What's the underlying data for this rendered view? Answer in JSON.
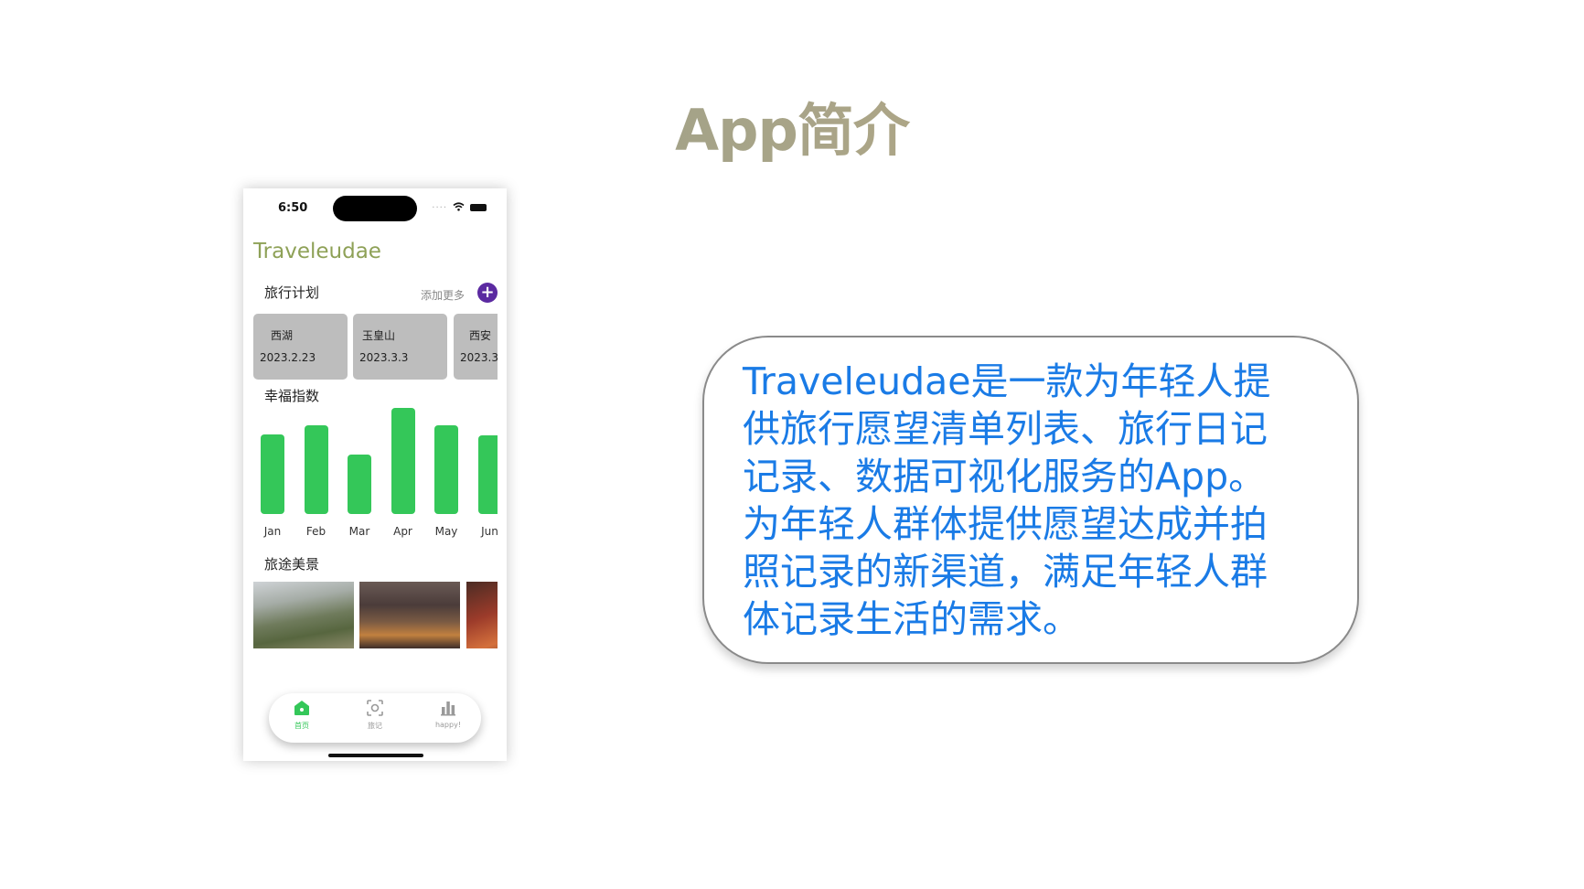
{
  "slide": {
    "title": "App简介"
  },
  "phone": {
    "status_time": "6:50",
    "app_title": "Traveleudae",
    "plan": {
      "title": "旅行计划",
      "add_more": "添加更多",
      "add_icon": "+",
      "cards": [
        {
          "name": "西湖",
          "date": "2023.2.23"
        },
        {
          "name": "玉皇山",
          "date": "2023.3.3"
        },
        {
          "name": "西安",
          "date": "2023.3"
        }
      ]
    },
    "happiness": {
      "title": "幸福指数",
      "months": [
        "Jan",
        "Feb",
        "Mar",
        "Apr",
        "May",
        "Jun"
      ],
      "values": [
        0.74,
        0.82,
        0.55,
        0.98,
        0.82,
        0.73
      ],
      "bar_color": "#34c759"
    },
    "scenery": {
      "title": "旅途美景"
    },
    "tabs": [
      {
        "label": "首页",
        "icon": "home-icon"
      },
      {
        "label": "旅记",
        "icon": "camera-icon"
      },
      {
        "label": "happy!",
        "icon": "bar-chart-icon"
      }
    ]
  },
  "description": {
    "lines": [
      "Traveleudae是一款为年轻人提",
      "供旅行愿望清单列表、旅行日记",
      "记录、数据可视化服务的App。",
      "为年轻人群体提供愿望达成并拍",
      "照记录的新渠道，满足年轻人群",
      "体记录生活的需求。"
    ]
  }
}
